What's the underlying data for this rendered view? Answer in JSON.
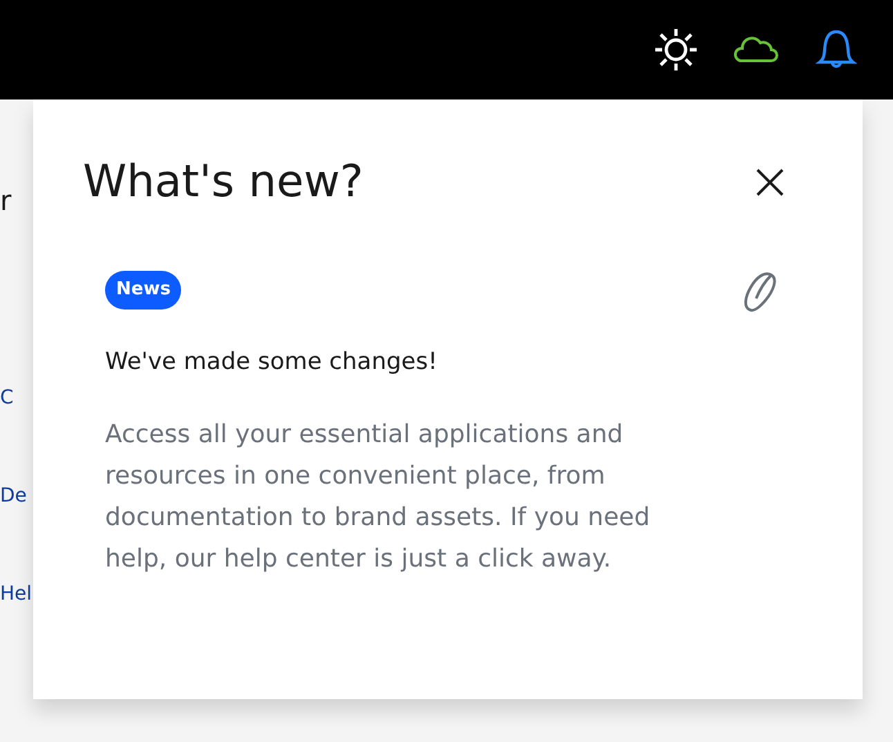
{
  "background_links": [
    {
      "label": "r",
      "kind": "heading"
    },
    {
      "label": "C",
      "kind": "link"
    },
    {
      "label": "De",
      "kind": "link"
    },
    {
      "label": "Hel",
      "kind": "link"
    }
  ],
  "panel": {
    "title": "What's new?",
    "tag": "News",
    "heading": "We've made some changes!",
    "body": "Access all your essential applications and resources in one convenient place, from documentation to brand assets. If you need help, our help center is just a click away."
  }
}
